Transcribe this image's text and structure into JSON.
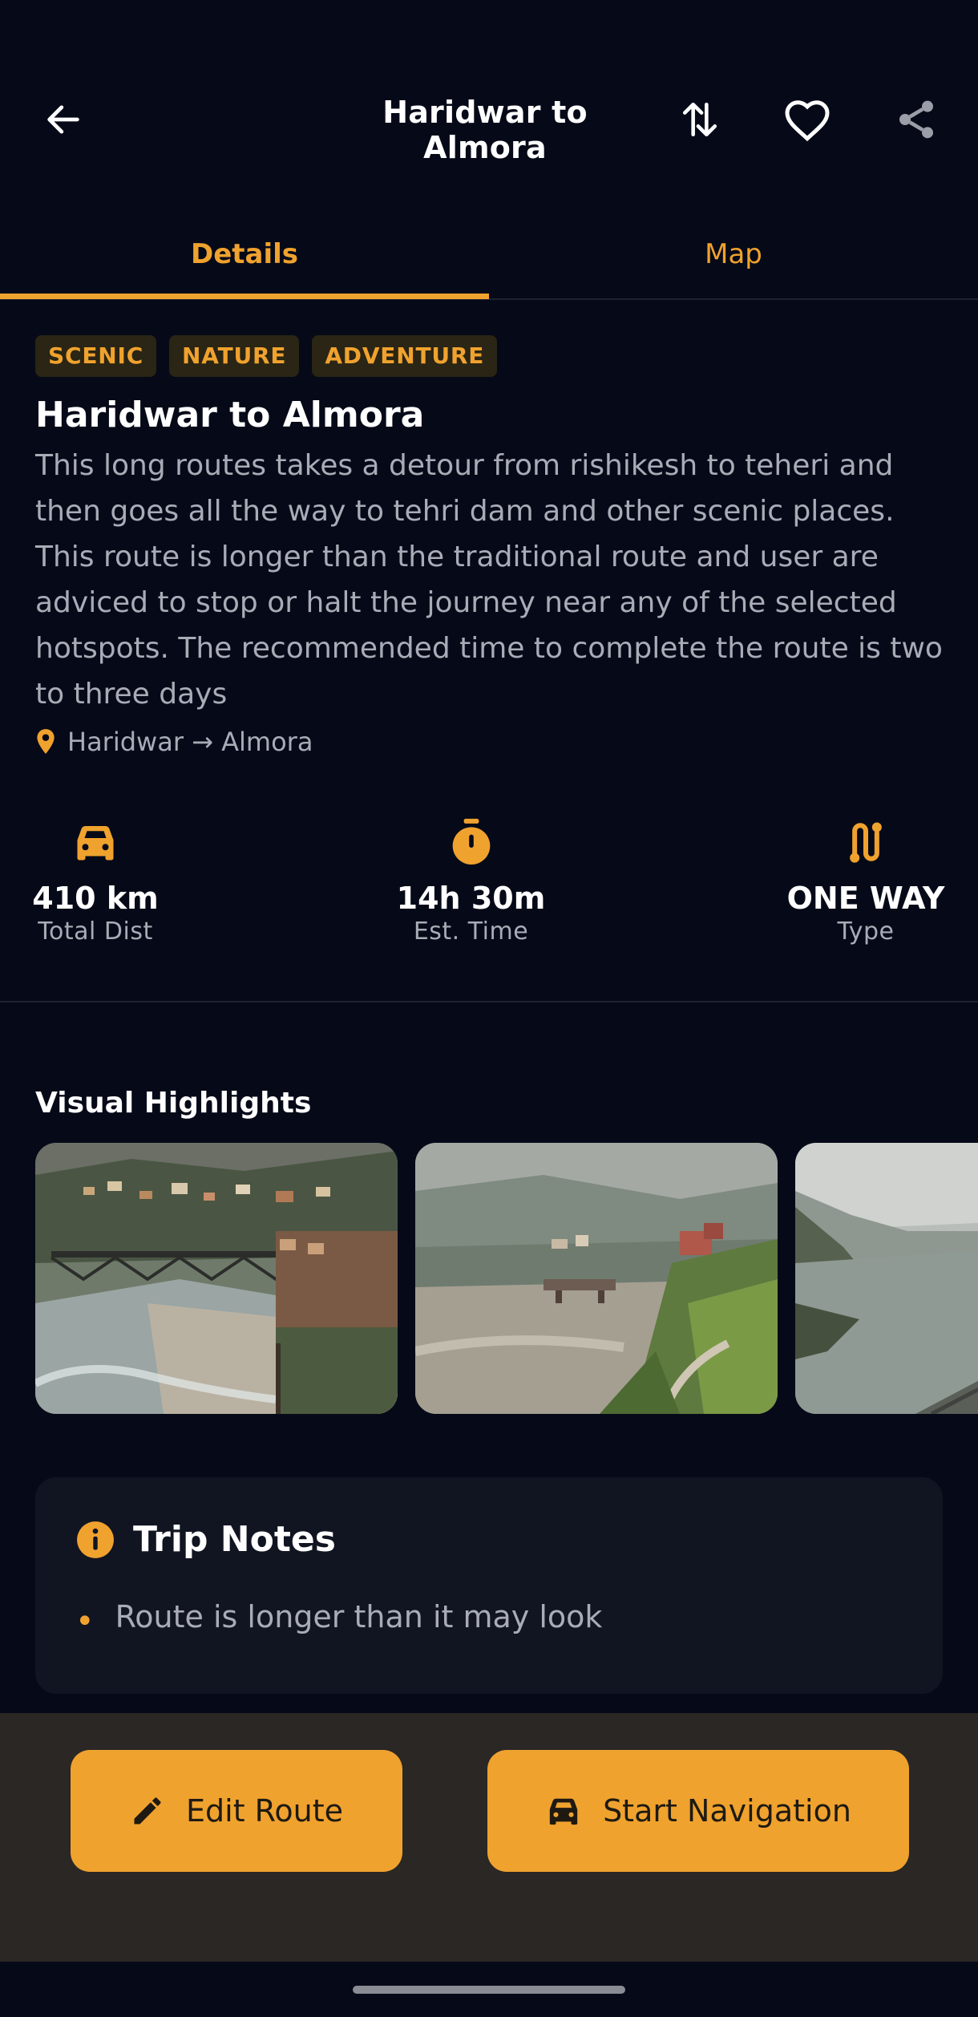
{
  "header": {
    "title": "Haridwar to Almora"
  },
  "tabs": [
    {
      "label": "Details",
      "active": true
    },
    {
      "label": "Map",
      "active": false
    }
  ],
  "tags": [
    "SCENIC",
    "NATURE",
    "ADVENTURE"
  ],
  "route": {
    "title": "Haridwar to Almora",
    "description": "This long routes takes a detour from rishikesh to teheri and then goes all the way to tehri dam and other scenic places. This route is longer than the traditional route and user are adviced to stop or halt the journey near any of the selected hotspots. The recommended time to complete the route is two to three days",
    "location": "Haridwar → Almora"
  },
  "stats": {
    "distance": {
      "value": "410 km",
      "label": "Total Dist"
    },
    "time": {
      "value": "14h 30m",
      "label": "Est. Time"
    },
    "type": {
      "value": "ONE WAY",
      "label": "Type"
    }
  },
  "highlights": {
    "title": "Visual Highlights"
  },
  "notes": {
    "title": "Trip Notes",
    "items": [
      "Route is longer than it may look"
    ]
  },
  "actions": {
    "edit": "Edit Route",
    "navigate": "Start Navigation"
  },
  "colors": {
    "accent": "#f0a22e",
    "background": "#060a18",
    "card": "#111522",
    "bottom_bar": "#2a2725"
  }
}
